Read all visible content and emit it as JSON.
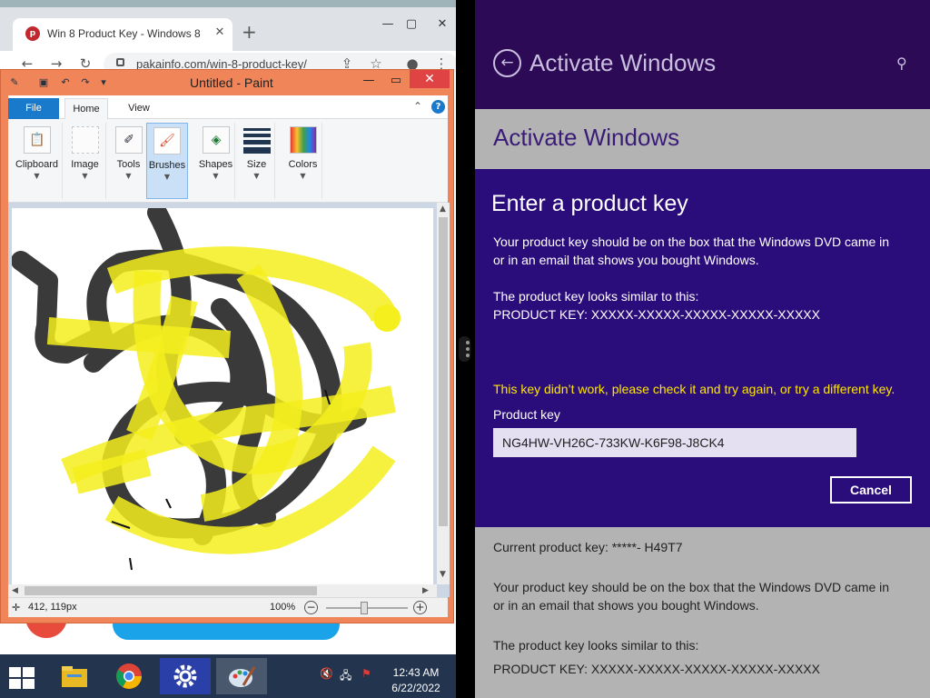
{
  "colors": {
    "activate_header": "#2c0a55",
    "activate_dialog": "#2a0d7a",
    "error_text": "#ffe600",
    "paint_frame": "#f0855a",
    "file_tab": "#1979ca",
    "taskbar": "#23344f"
  },
  "chrome": {
    "tab_title": "Win 8 Product Key - Windows 8",
    "url": "pakainfo.com/win-8-product-key/",
    "icons": [
      "back-icon",
      "forward-icon",
      "reload-icon",
      "lock-icon",
      "share-icon",
      "star-icon",
      "profile-icon",
      "menu-icon"
    ]
  },
  "paint": {
    "title": "Untitled - Paint",
    "tabs": [
      "File",
      "Home",
      "View"
    ],
    "groups": [
      {
        "label": "Clipboard",
        "icon": "clipboard-icon"
      },
      {
        "label": "Image",
        "icon": "select-icon"
      },
      {
        "label": "Tools",
        "icon": "tools-icon"
      },
      {
        "label": "Brushes",
        "icon": "brush-icon",
        "selected": true
      },
      {
        "label": "Shapes",
        "icon": "shapes-icon"
      },
      {
        "label": "Size",
        "icon": "size-icon"
      },
      {
        "label": "Colors",
        "icon": "palette-icon"
      }
    ],
    "status": {
      "coords": "412, 119px",
      "zoom": "100%"
    }
  },
  "activate": {
    "header_title": "Activate Windows",
    "section_title": "Activate Windows",
    "dialog_title": "Enter a product key",
    "desc_line1": "Your product key should be on the box that the Windows DVD came in",
    "desc_line2": "or in an email that shows you bought Windows.",
    "similar_line1": "The product key looks similar to this:",
    "similar_line2": "PRODUCT KEY: XXXXX-XXXXX-XXXXX-XXXXX-XXXXX",
    "error": "This key didn’t work, please check it and try again, or try a different key.",
    "product_key_label": "Product key",
    "product_key_value": "NG4HW-VH26C-733KW-K6F98-J8CK4",
    "cancel": "Cancel",
    "current_key": "Current product key: *****- H49T7",
    "lower_desc_line1": "Your product key should be on the box that the Windows DVD came in",
    "lower_desc_line2": "or in an email that shows you bought Windows.",
    "lower_similar_line1": "The product key looks similar to this:",
    "lower_similar_line2": "PRODUCT KEY: XXXXX-XXXXX-XXXXX-XXXXX-XXXXX"
  },
  "taskbar": {
    "apps": [
      "file-explorer-icon",
      "chrome-icon",
      "settings-icon",
      "paint-icon"
    ],
    "time": "12:43 AM",
    "date": "6/22/2022"
  }
}
